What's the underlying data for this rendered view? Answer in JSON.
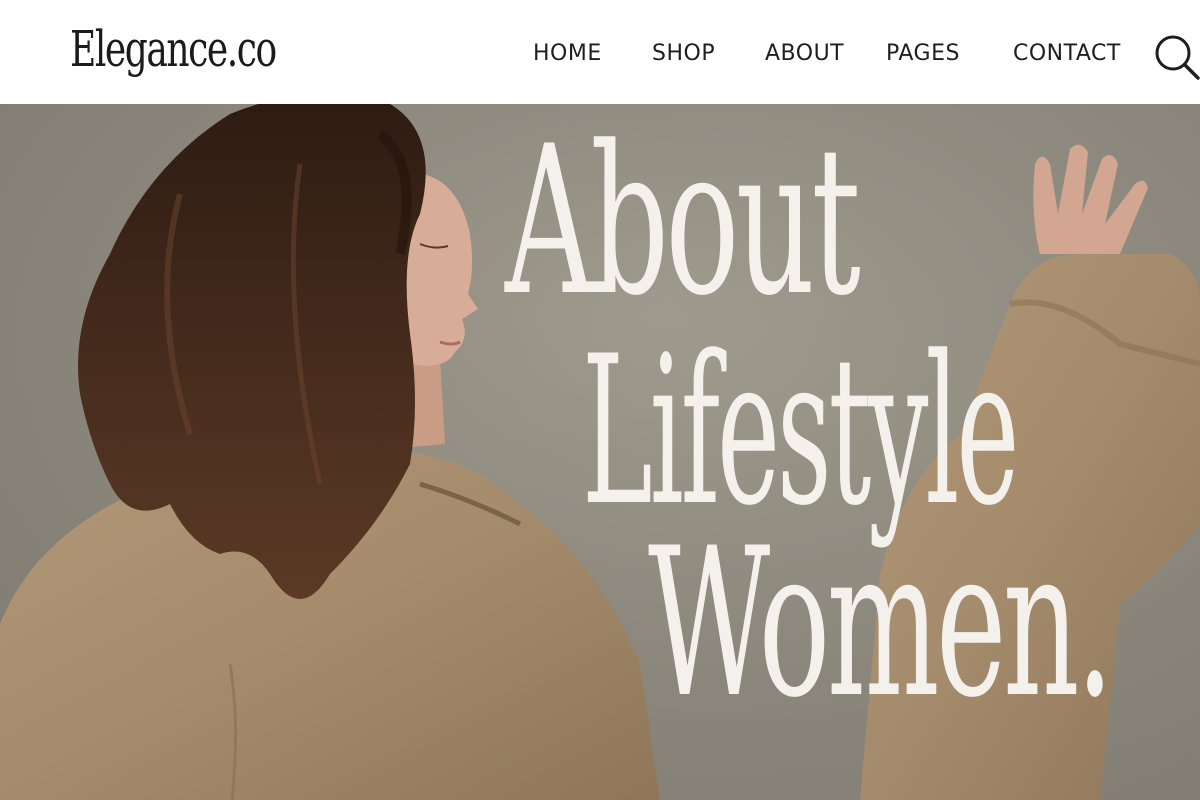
{
  "header": {
    "logo": "Elegance.co",
    "nav": [
      {
        "label": "HOME"
      },
      {
        "label": "SHOP"
      },
      {
        "label": "ABOUT"
      },
      {
        "label": "PAGES"
      },
      {
        "label": "CONTACT"
      }
    ],
    "search_icon": "search-icon"
  },
  "hero": {
    "headline_lines": [
      "About",
      "Lifestyle",
      "Women."
    ],
    "colors": {
      "background": "#8d887d",
      "coat": "#a48b6c",
      "hair": "#3b2417",
      "skin": "#d8ad98",
      "headline_text": "#f4f1ec"
    }
  }
}
